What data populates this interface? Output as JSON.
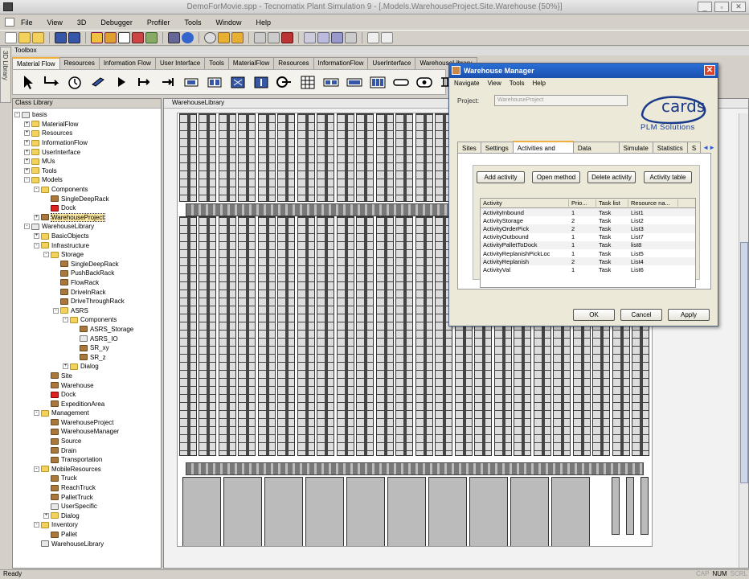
{
  "window": {
    "title": "DemoForMovie.spp - Tecnomatix Plant Simulation 9 - [.Models.WarehouseProject.Site.Warehouse  {50%}]"
  },
  "menu": [
    "File",
    "View",
    "3D",
    "Debugger",
    "Profiler",
    "Tools",
    "Window",
    "Help"
  ],
  "toolbox": {
    "title": "Toolbox",
    "side_label": "3D Library",
    "tabs": [
      "Material Flow",
      "Resources",
      "Information Flow",
      "User Interface",
      "Tools",
      "MaterialFlow",
      "Resources",
      "InformationFlow",
      "UserInterface",
      "WarehouseLibrary"
    ],
    "active_tab": 0
  },
  "class_library": {
    "title": "Class Library",
    "items": [
      {
        "label": "basis",
        "level": 0,
        "exp": "-",
        "icon": "obj2"
      },
      {
        "label": "MaterialFlow",
        "level": 1,
        "exp": "+",
        "icon": "folder"
      },
      {
        "label": "Resources",
        "level": 1,
        "exp": "+",
        "icon": "folder"
      },
      {
        "label": "InformationFlow",
        "level": 1,
        "exp": "+",
        "icon": "folder"
      },
      {
        "label": "UserInterface",
        "level": 1,
        "exp": "+",
        "icon": "folder"
      },
      {
        "label": "MUs",
        "level": 1,
        "exp": "+",
        "icon": "folder"
      },
      {
        "label": "Tools",
        "level": 1,
        "exp": "+",
        "icon": "folder"
      },
      {
        "label": "Models",
        "level": 1,
        "exp": "-",
        "icon": "folder"
      },
      {
        "label": "Components",
        "level": 2,
        "exp": "-",
        "icon": "folder"
      },
      {
        "label": "SingleDeepRack",
        "level": 3,
        "exp": "",
        "icon": "obj"
      },
      {
        "label": "Dock",
        "level": 3,
        "exp": "",
        "icon": "red"
      },
      {
        "label": "WarehouseProject",
        "level": 2,
        "exp": "+",
        "icon": "obj",
        "selected": true
      },
      {
        "label": "WarehouseLibrary",
        "level": 1,
        "exp": "-",
        "icon": "obj2"
      },
      {
        "label": "BasicObjects",
        "level": 2,
        "exp": "+",
        "icon": "folder"
      },
      {
        "label": "Infrastructure",
        "level": 2,
        "exp": "-",
        "icon": "folder"
      },
      {
        "label": "Storage",
        "level": 3,
        "exp": "-",
        "icon": "folder"
      },
      {
        "label": "SingleDeepRack",
        "level": 4,
        "exp": "",
        "icon": "obj"
      },
      {
        "label": "PushBackRack",
        "level": 4,
        "exp": "",
        "icon": "obj"
      },
      {
        "label": "FlowRack",
        "level": 4,
        "exp": "",
        "icon": "obj"
      },
      {
        "label": "DriveInRack",
        "level": 4,
        "exp": "",
        "icon": "obj"
      },
      {
        "label": "DriveThroughRack",
        "level": 4,
        "exp": "",
        "icon": "obj"
      },
      {
        "label": "ASRS",
        "level": 4,
        "exp": "-",
        "icon": "folder"
      },
      {
        "label": "Components",
        "level": 5,
        "exp": "-",
        "icon": "folder"
      },
      {
        "label": "ASRS_Storage",
        "level": 6,
        "exp": "",
        "icon": "obj"
      },
      {
        "label": "ASRS_IO",
        "level": 6,
        "exp": "",
        "icon": "obj2"
      },
      {
        "label": "SR_xy",
        "level": 6,
        "exp": "",
        "icon": "obj"
      },
      {
        "label": "SR_z",
        "level": 6,
        "exp": "",
        "icon": "obj"
      },
      {
        "label": "Dialog",
        "level": 5,
        "exp": "+",
        "icon": "folder"
      },
      {
        "label": "Site",
        "level": 3,
        "exp": "",
        "icon": "obj"
      },
      {
        "label": "Warehouse",
        "level": 3,
        "exp": "",
        "icon": "obj"
      },
      {
        "label": "Dock",
        "level": 3,
        "exp": "",
        "icon": "red"
      },
      {
        "label": "ExpeditionArea",
        "level": 3,
        "exp": "",
        "icon": "obj"
      },
      {
        "label": "Management",
        "level": 2,
        "exp": "-",
        "icon": "folder"
      },
      {
        "label": "WarehouseProject",
        "level": 3,
        "exp": "",
        "icon": "obj"
      },
      {
        "label": "WarehouseManager",
        "level": 3,
        "exp": "",
        "icon": "obj"
      },
      {
        "label": "Source",
        "level": 3,
        "exp": "",
        "icon": "obj"
      },
      {
        "label": "Drain",
        "level": 3,
        "exp": "",
        "icon": "obj"
      },
      {
        "label": "Transportation",
        "level": 3,
        "exp": "",
        "icon": "obj"
      },
      {
        "label": "MobileResources",
        "level": 2,
        "exp": "-",
        "icon": "folder"
      },
      {
        "label": "Truck",
        "level": 3,
        "exp": "",
        "icon": "obj"
      },
      {
        "label": "ReachTruck",
        "level": 3,
        "exp": "",
        "icon": "obj"
      },
      {
        "label": "PalletTruck",
        "level": 3,
        "exp": "",
        "icon": "obj"
      },
      {
        "label": "UserSpecific",
        "level": 3,
        "exp": "",
        "icon": "obj2"
      },
      {
        "label": "Dialog",
        "level": 3,
        "exp": "+",
        "icon": "folder"
      },
      {
        "label": "Inventory",
        "level": 2,
        "exp": "-",
        "icon": "folder"
      },
      {
        "label": "Pallet",
        "level": 3,
        "exp": "",
        "icon": "obj"
      },
      {
        "label": "WarehouseLibrary",
        "level": 2,
        "exp": "",
        "icon": "obj2"
      }
    ]
  },
  "workarea": {
    "tab": "WarehouseLibrary"
  },
  "dialog": {
    "title": "Warehouse Manager",
    "menu": [
      "Navigate",
      "View",
      "Tools",
      "Help"
    ],
    "project_label": "Project:",
    "project_value": "WarehouseProject",
    "logo_text": "cards",
    "logo_sub": "PLM Solutions",
    "tabs": [
      "Sites",
      "Settings",
      "Activities and Tasks",
      "Data interface",
      "Simulate",
      "Statistics",
      "S"
    ],
    "active_tab": 2,
    "buttons": {
      "add": "Add activity",
      "open": "Open method",
      "delete": "Delete activity",
      "table": "Activity table"
    },
    "table": {
      "headers": [
        "Activity",
        "Prio...",
        "Task list",
        "Resource na..."
      ],
      "rows": [
        [
          "ActivityInbound",
          "1",
          "Task",
          "List1"
        ],
        [
          "ActivityStorage",
          "2",
          "Task",
          "List2"
        ],
        [
          "ActivityOrderPick",
          "2",
          "Task",
          "List3"
        ],
        [
          "ActivityOutbound",
          "1",
          "Task",
          "List7"
        ],
        [
          "ActivityPalletToDock",
          "1",
          "Task",
          "list8"
        ],
        [
          "ActivityReplanishPickLoc",
          "1",
          "Task",
          "List5"
        ],
        [
          "ActivityReplanish",
          "2",
          "Task",
          "List4"
        ],
        [
          "ActivityVal",
          "1",
          "Task",
          "List6"
        ]
      ]
    },
    "ok": "OK",
    "cancel": "Cancel",
    "apply": "Apply"
  },
  "status": {
    "left": "Ready",
    "cap": "CAP",
    "num": "NUM",
    "scrl": "SCRL"
  }
}
